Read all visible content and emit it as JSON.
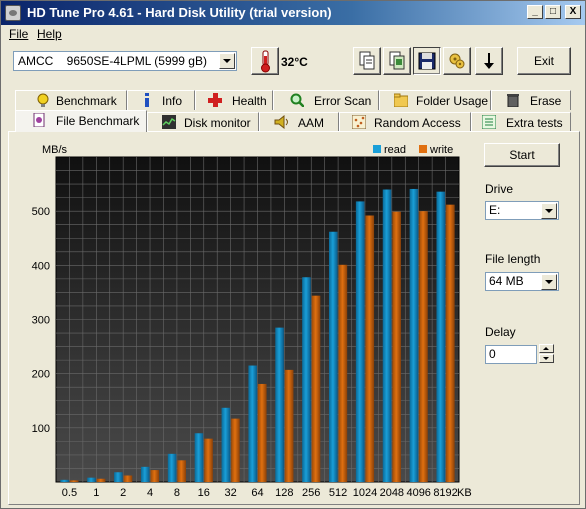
{
  "window": {
    "title": "HD Tune Pro 4.61 - Hard Disk Utility (trial version)",
    "controls": [
      "_",
      "□",
      "X"
    ]
  },
  "menu": {
    "file": "File",
    "help": "Help"
  },
  "toolbar": {
    "drive": "AMCC    9650SE-4LPML (5999 gB)",
    "temperature": "32°C",
    "exit_label": "Exit",
    "icons": [
      "copy-info-icon",
      "copy-screenshot-icon",
      "save-icon",
      "options-icon",
      "download-icon"
    ]
  },
  "tabs": {
    "row1": [
      {
        "label": "Benchmark",
        "icon": "benchmark-icon",
        "color": "#e0c000"
      },
      {
        "label": "Info",
        "icon": "info-icon",
        "color": "#2050c0"
      },
      {
        "label": "Health",
        "icon": "health-icon",
        "color": "#d02020"
      },
      {
        "label": "Error Scan",
        "icon": "error-scan-icon",
        "color": "#208020"
      },
      {
        "label": "Folder Usage",
        "icon": "folder-icon",
        "color": "#e0b030"
      },
      {
        "label": "Erase",
        "icon": "erase-icon",
        "color": "#606060"
      }
    ],
    "row2": [
      {
        "label": "File Benchmark",
        "icon": "file-benchmark-icon",
        "color": "#a040a0",
        "active": true
      },
      {
        "label": "Disk monitor",
        "icon": "disk-monitor-icon",
        "color": "#303030"
      },
      {
        "label": "AAM",
        "icon": "speaker-icon",
        "color": "#c0a000"
      },
      {
        "label": "Random Access",
        "icon": "random-access-icon",
        "color": "#c09040"
      },
      {
        "label": "Extra tests",
        "icon": "extra-tests-icon",
        "color": "#208040"
      }
    ]
  },
  "controls": {
    "start_label": "Start",
    "drive_label": "Drive",
    "drive_value": "E:",
    "file_length_label": "File length",
    "file_length_value": "64 MB",
    "delay_label": "Delay",
    "delay_value": "0"
  },
  "chart_data": {
    "type": "bar",
    "ylabel": "MB/s",
    "xunit": "KB",
    "ylim": [
      0,
      600
    ],
    "yticks": [
      100,
      200,
      300,
      400,
      500
    ],
    "categories": [
      "0.5",
      "1",
      "2",
      "4",
      "8",
      "16",
      "32",
      "64",
      "128",
      "256",
      "512",
      "1024",
      "2048",
      "4096",
      "8192"
    ],
    "legend_position": "top-right",
    "series": [
      {
        "name": "read",
        "color": "#1a9fd8",
        "values": [
          4,
          8,
          18,
          28,
          52,
          90,
          137,
          215,
          285,
          378,
          462,
          518,
          540,
          541,
          536
        ]
      },
      {
        "name": "write",
        "color": "#e07010",
        "values": [
          3,
          6,
          12,
          22,
          40,
          80,
          117,
          181,
          207,
          344,
          401,
          492,
          499,
          500,
          512
        ]
      }
    ]
  }
}
